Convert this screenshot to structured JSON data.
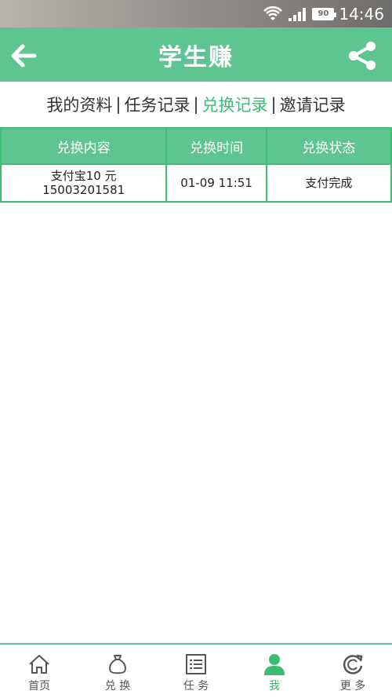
{
  "status_bar": {
    "battery": "90",
    "time": "14:46"
  },
  "app_bar": {
    "title": "学生赚"
  },
  "tabs": [
    {
      "label": "我的资料",
      "active": false
    },
    {
      "label": "任务记录",
      "active": false
    },
    {
      "label": "兑换记录",
      "active": true
    },
    {
      "label": "邀请记录",
      "active": false
    }
  ],
  "tab_separator": "|",
  "table": {
    "headers": [
      "兑换内容",
      "兑换时间",
      "兑换状态"
    ],
    "rows": [
      {
        "content_line1": "支付宝10 元",
        "content_line2": "15003201581",
        "time": "01-09 11:51",
        "status": "支付完成"
      }
    ]
  },
  "bottom_nav": [
    {
      "label": "首页",
      "icon": "home-icon",
      "active": false
    },
    {
      "label": "兑 换",
      "icon": "money-bag-icon",
      "active": false
    },
    {
      "label": "任 务",
      "icon": "task-list-icon",
      "active": false
    },
    {
      "label": "我",
      "icon": "user-icon",
      "active": true
    },
    {
      "label": "更 多",
      "icon": "refresh-more-icon",
      "active": false
    }
  ],
  "colors": {
    "primary": "#5ec592",
    "active_text": "#3dbb73",
    "border": "#3fbf74"
  }
}
